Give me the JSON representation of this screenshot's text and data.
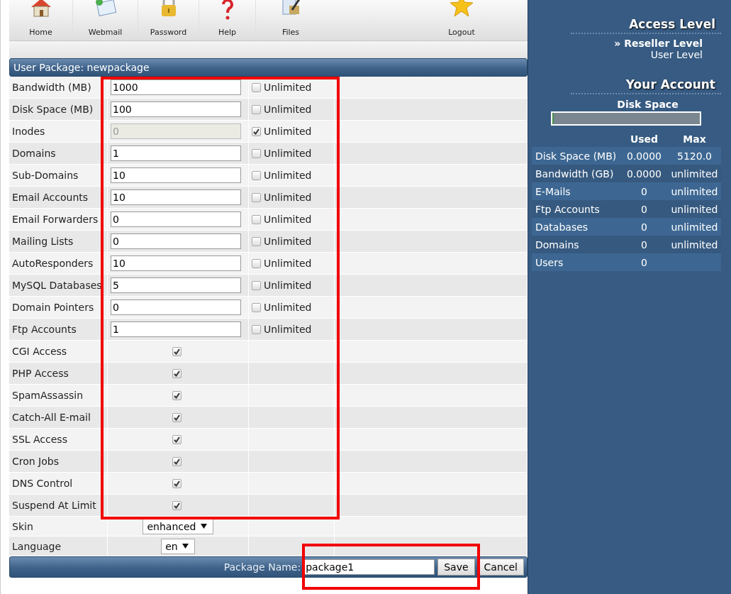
{
  "toolbar": [
    {
      "kind": "home",
      "label": "Home"
    },
    {
      "kind": "mail",
      "label": "Webmail"
    },
    {
      "kind": "lock",
      "label": "Password"
    },
    {
      "kind": "help",
      "label": "Help"
    },
    {
      "kind": "files",
      "label": "Files"
    },
    {
      "kind": "star",
      "label": "Logout"
    }
  ],
  "package": {
    "title": "User Package: newpackage",
    "rows": [
      {
        "kind": "limit",
        "label": "Bandwidth (MB)",
        "value": "1000",
        "unlimited": false,
        "unlimited_label": "Unlimited"
      },
      {
        "kind": "limit",
        "label": "Disk Space (MB)",
        "value": "100",
        "unlimited": false,
        "unlimited_label": "Unlimited"
      },
      {
        "kind": "limit",
        "label": "Inodes",
        "value": "0",
        "unlimited": true,
        "unlimited_label": "Unlimited"
      },
      {
        "kind": "limit",
        "label": "Domains",
        "value": "1",
        "unlimited": false,
        "unlimited_label": "Unlimited"
      },
      {
        "kind": "limit",
        "label": "Sub-Domains",
        "value": "10",
        "unlimited": false,
        "unlimited_label": "Unlimited"
      },
      {
        "kind": "limit",
        "label": "Email Accounts",
        "value": "10",
        "unlimited": false,
        "unlimited_label": "Unlimited"
      },
      {
        "kind": "limit",
        "label": "Email Forwarders",
        "value": "0",
        "unlimited": false,
        "unlimited_label": "Unlimited"
      },
      {
        "kind": "limit",
        "label": "Mailing Lists",
        "value": "0",
        "unlimited": false,
        "unlimited_label": "Unlimited"
      },
      {
        "kind": "limit",
        "label": "AutoResponders",
        "value": "10",
        "unlimited": false,
        "unlimited_label": "Unlimited"
      },
      {
        "kind": "limit",
        "label": "MySQL Databases",
        "value": "5",
        "unlimited": false,
        "unlimited_label": "Unlimited"
      },
      {
        "kind": "limit",
        "label": "Domain Pointers",
        "value": "0",
        "unlimited": false,
        "unlimited_label": "Unlimited"
      },
      {
        "kind": "limit",
        "label": "Ftp Accounts",
        "value": "1",
        "unlimited": false,
        "unlimited_label": "Unlimited"
      },
      {
        "kind": "toggle",
        "label": "CGI Access",
        "checked": true
      },
      {
        "kind": "toggle",
        "label": "PHP Access",
        "checked": true
      },
      {
        "kind": "toggle",
        "label": "SpamAssassin",
        "checked": true
      },
      {
        "kind": "toggle",
        "label": "Catch-All E-mail",
        "checked": true
      },
      {
        "kind": "toggle",
        "label": "SSL Access",
        "checked": true
      },
      {
        "kind": "toggle",
        "label": "Cron Jobs",
        "checked": true
      },
      {
        "kind": "toggle",
        "label": "DNS Control",
        "checked": true
      },
      {
        "kind": "toggle",
        "label": "Suspend At Limit",
        "checked": true
      },
      {
        "kind": "select",
        "label": "Skin",
        "value": "enhanced"
      },
      {
        "kind": "select",
        "label": "Language",
        "value": "en"
      }
    ],
    "name_label": "Package Name:",
    "name_value": "package1",
    "buttons": [
      "Save",
      "Cancel"
    ]
  },
  "sidebar": {
    "access_title": "Access Level",
    "levels": [
      {
        "label": "Reseller Level",
        "marker": "»",
        "selected": true
      },
      {
        "label": "User Level",
        "selected": false
      }
    ],
    "account_title": "Your Account",
    "disk": {
      "label": "Disk Space",
      "level": 0.01
    },
    "columns": [
      "Used",
      "Max"
    ],
    "rows": [
      {
        "name": "Disk Space (MB)",
        "used": "0.0000",
        "max": "5120.0"
      },
      {
        "name": "Bandwidth (GB)",
        "used": "0.0000",
        "max": "unlimited"
      },
      {
        "name": "E-Mails",
        "used": "0",
        "max": "unlimited"
      },
      {
        "name": "Ftp Accounts",
        "used": "0",
        "max": "unlimited"
      },
      {
        "name": "Databases",
        "used": "0",
        "max": "unlimited"
      },
      {
        "name": "Domains",
        "used": "0",
        "max": "unlimited"
      },
      {
        "name": "Users",
        "used": "0"
      }
    ]
  }
}
